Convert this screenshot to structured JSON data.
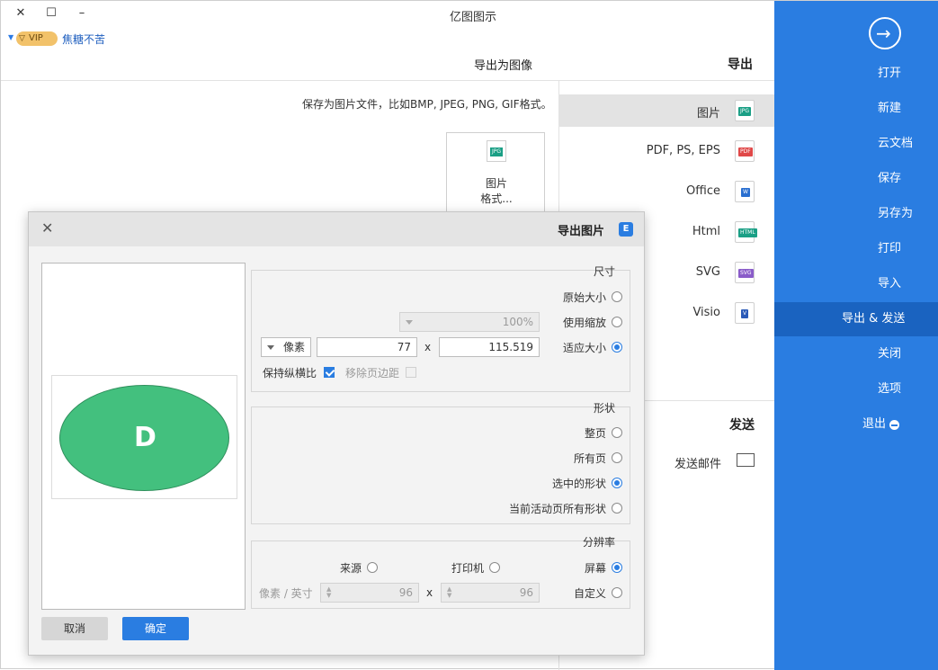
{
  "app": {
    "title": "亿图图示"
  },
  "window_controls": {
    "close": "✕",
    "maximize": "☐",
    "minimize": "–"
  },
  "user": {
    "name": "焦糖不苦",
    "vip": "VIP"
  },
  "sidebar": {
    "items": [
      {
        "label": "打开"
      },
      {
        "label": "新建"
      },
      {
        "label": "云文档"
      },
      {
        "label": "保存"
      },
      {
        "label": "另存为"
      },
      {
        "label": "打印"
      },
      {
        "label": "导入"
      },
      {
        "label": "导出 & 发送"
      },
      {
        "label": "关闭"
      },
      {
        "label": "选项"
      },
      {
        "label": "退出"
      }
    ],
    "active_index": 7
  },
  "export": {
    "header": "导出",
    "image_header": "导出为图像",
    "description": "保存为图片文件，比如BMP, JPEG, PNG, GIF格式。",
    "formats": [
      {
        "label": "图片",
        "tag": "JPG",
        "color": "#1a9f85"
      },
      {
        "label": "PDF, PS, EPS",
        "tag": "PDF",
        "color": "#e04848"
      },
      {
        "label": "Office",
        "tag": "W",
        "color": "#2a6fd0"
      },
      {
        "label": "Html",
        "tag": "HTML",
        "color": "#1a9f85"
      },
      {
        "label": "SVG",
        "tag": "SVG",
        "color": "#8a5cc9"
      },
      {
        "label": "Visio",
        "tag": "V",
        "color": "#2a5ab8"
      }
    ],
    "card_label": "图片\n格式...",
    "send_header": "发送",
    "send_mail": "发送邮件"
  },
  "dialog": {
    "title": "导出图片",
    "logo": "E",
    "close": "✕",
    "preview_letter": "D",
    "size": {
      "title": "尺寸",
      "options": [
        "原始大小",
        "使用缩放",
        "适应大小"
      ],
      "selected": 2,
      "zoom_value": "100%",
      "width": "115.519",
      "height": "77",
      "unit": "像素",
      "x": "x",
      "remove_margin": "移除页边距",
      "keep_ratio": "保持纵横比"
    },
    "shape": {
      "title": "形状",
      "options": [
        "整页",
        "所有页",
        "选中的形状",
        "当前活动页所有形状"
      ],
      "selected": 2
    },
    "resolution": {
      "title": "分辨率",
      "options": [
        "屏幕",
        "打印机",
        "来源",
        "自定义"
      ],
      "selected": 0,
      "custom_w": "96",
      "custom_h": "96",
      "unit": "像素 / 英寸",
      "x": "x"
    },
    "ok": "确定",
    "cancel": "取消"
  }
}
